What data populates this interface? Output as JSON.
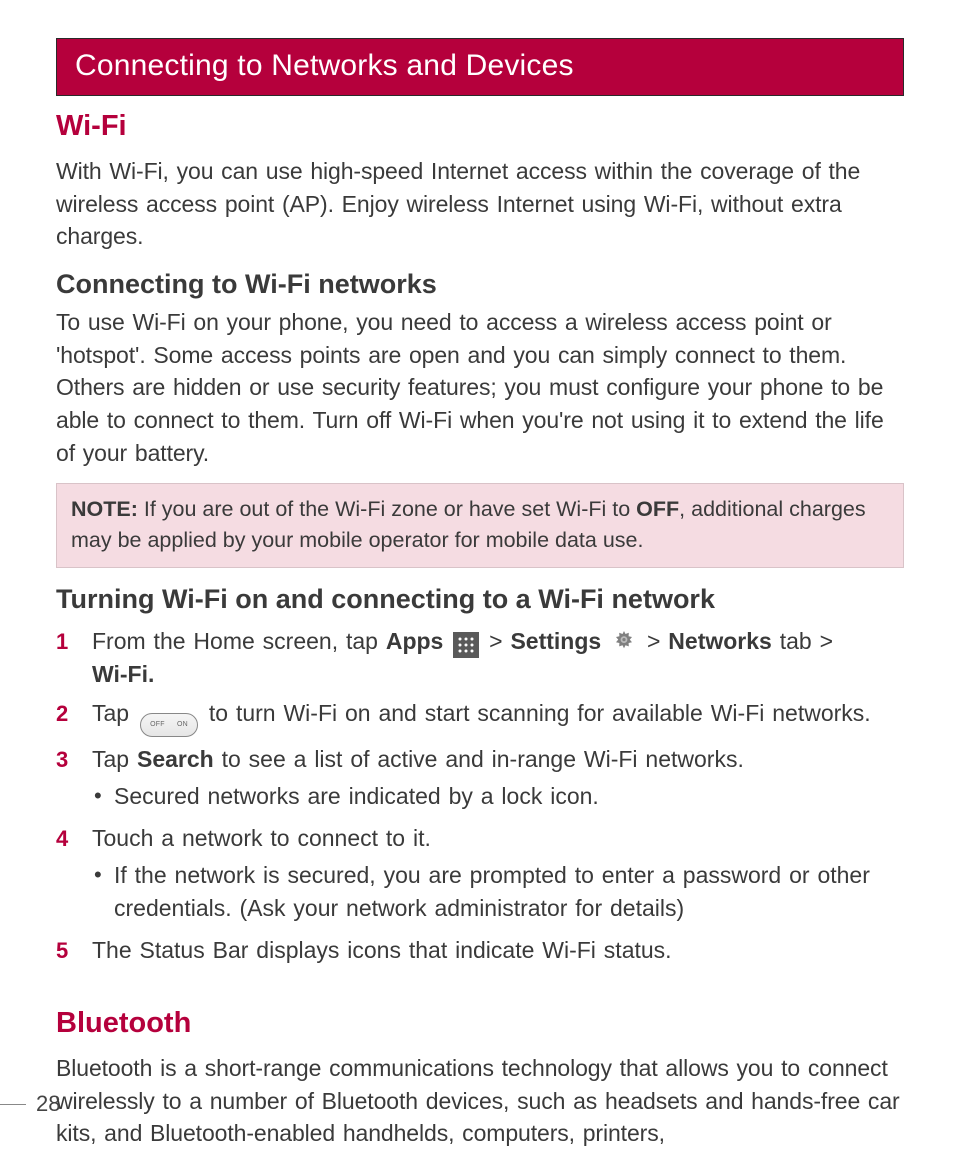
{
  "chapter": {
    "title": "Connecting to Networks and Devices"
  },
  "wifi": {
    "heading": "Wi-Fi",
    "intro": "With Wi-Fi, you can use high-speed Internet access within the coverage of the wireless access point (AP). Enjoy wireless Internet using Wi-Fi, without extra charges.",
    "connecting": {
      "heading": "Connecting to Wi-Fi networks",
      "body": "To use Wi-Fi on your phone, you need to access a wireless access point or 'hotspot'. Some access points are open and you can simply connect to them. Others are hidden or use security features; you must configure your phone to be able to connect to them. Turn off Wi-Fi when you're not using it to extend the life of your battery."
    },
    "note": {
      "label": "NOTE:",
      "pre": " If you are out of the Wi-Fi zone or have set Wi-Fi to ",
      "off": "OFF",
      "post": ", additional charges may be applied by your mobile operator for mobile data use."
    },
    "turning_on": {
      "heading": "Turning Wi-Fi on and connecting to a Wi-Fi network",
      "steps": {
        "s1": {
          "pre": "From the Home screen, tap ",
          "apps": "Apps",
          "gt1": " > ",
          "settings": "Settings",
          "gt2": " > ",
          "networks": "Networks",
          "tab": " tab > ",
          "wifi": "Wi-Fi."
        },
        "s2": {
          "pre": "Tap ",
          "toggle_off": "OFF",
          "toggle_on": "ON",
          "post": " to turn Wi-Fi on and start scanning for available Wi-Fi networks."
        },
        "s3": {
          "pre": "Tap ",
          "search": "Search",
          "post": " to see a list of active and in-range Wi-Fi networks.",
          "bullet": "Secured networks are indicated by a lock icon."
        },
        "s4": {
          "text": "Touch a network to connect to it.",
          "bullet": "If the network is secured, you are prompted to enter a password or other credentials. (Ask your network administrator for details)"
        },
        "s5": {
          "text": "The Status Bar displays icons that indicate Wi-Fi status."
        }
      }
    }
  },
  "bluetooth": {
    "heading": "Bluetooth",
    "body": "Bluetooth is a short-range communications technology that allows you to connect wirelessly to a number of Bluetooth devices, such as headsets and hands-free car kits, and Bluetooth-enabled handhelds, computers, printers,"
  },
  "nums": {
    "n1": "1",
    "n2": "2",
    "n3": "3",
    "n4": "4",
    "n5": "5"
  },
  "page_number": "28"
}
